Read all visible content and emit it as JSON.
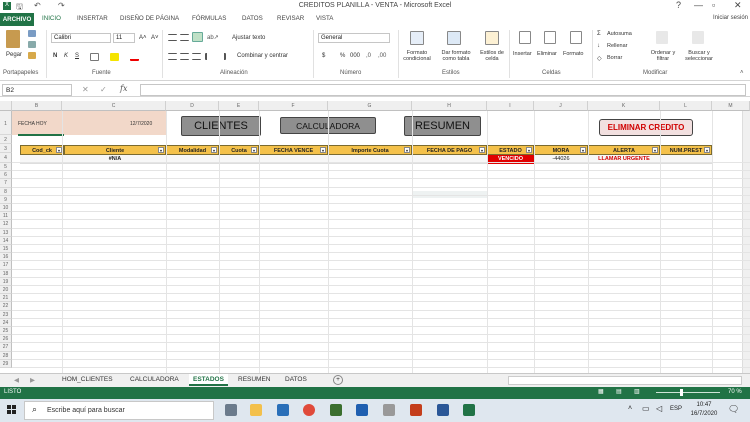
{
  "window": {
    "title": "CREDITOS PLANILLA - VENTA - Microsoft Excel",
    "help": "?",
    "minimize": "—",
    "maximize": "▫",
    "close": "✕",
    "signin": "Iniciar sesión"
  },
  "ribbon_tabs": [
    "ARCHIVO",
    "INICIO",
    "INSERTAR",
    "DISEÑO DE PÁGINA",
    "FÓRMULAS",
    "DATOS",
    "REVISAR",
    "VISTA"
  ],
  "ribbon": {
    "paste": "Pegar",
    "clipboard": "Portapapeles",
    "font_name": "Calibri",
    "font_size": "11",
    "grow": "A˄",
    "shrink": "A˅",
    "bold": "N",
    "italic": "K",
    "underline": "S",
    "font_group": "Fuente",
    "wrap_text": "Ajustar texto",
    "merge": "Combinar y centrar",
    "alignment_group": "Alineación",
    "number_format": "General",
    "currency": "$",
    "percent": "%",
    "thousands": "000",
    "number_group": "Número",
    "cond_format": "Formato condicional",
    "table_format": "Dar formato como tabla",
    "cell_styles": "Estilos de celda",
    "styles_group": "Estilos",
    "insert": "Insertar",
    "delete": "Eliminar",
    "format": "Formato",
    "cells_group": "Celdas",
    "autosum": "Autosuma",
    "fill": "Rellenar",
    "clear": "Borrar",
    "sort_filter": "Ordenar y filtrar",
    "find_select": "Buscar y seleccionar",
    "editing_group": "Modificar"
  },
  "formula_bar": {
    "name_box": "B2",
    "fx": "fx",
    "value": ""
  },
  "columns": [
    "B",
    "C",
    "D",
    "E",
    "F",
    "G",
    "H",
    "I",
    "J",
    "K",
    "L",
    "M"
  ],
  "rows": [
    "1",
    "2",
    "3",
    "4",
    "5",
    "6",
    "7",
    "8",
    "9",
    "10",
    "11",
    "12",
    "13",
    "14",
    "15",
    "16",
    "17",
    "18",
    "19",
    "20",
    "21",
    "22",
    "23",
    "24",
    "25",
    "26",
    "27",
    "28",
    "29"
  ],
  "sheet": {
    "date_label": "FECHA HOY",
    "date_value": "12/7/2020",
    "btn_clientes": "CLIENTES",
    "btn_calculadora": "CALCULADORA",
    "btn_resumen": "RESUMEN",
    "btn_eliminar": "ELIMINAR CREDITO",
    "headers": [
      "Cod_ck",
      "Cliente",
      "Modalidad",
      "Cuota",
      "FECHA VENCE",
      "Importe Cuota",
      "FECHA DE PAGO",
      "ESTADO",
      "MORA",
      "ALERTA",
      "NUM.PREST"
    ],
    "row": {
      "cliente": "#N/A",
      "estado": "VENCIDO",
      "mora": "-44026",
      "alerta": "LLAMAR URGENTE"
    }
  },
  "sheet_tabs": [
    "HOM_CLIENTES",
    "CALCULADORA",
    "ESTADOS",
    "RESUMEN",
    "DATOS"
  ],
  "add_sheet": "+",
  "status": {
    "ready": "LISTO",
    "zoom": "70 %"
  },
  "taskbar": {
    "search_placeholder": "Escribe aquí para buscar",
    "lang": "ESP",
    "time": "10:47",
    "date": "16/7/2020"
  },
  "colors": {
    "excel_green": "#217346",
    "header_yellow": "#f4c14a",
    "vencido_red": "#e00000",
    "alert_red": "#d40000"
  }
}
